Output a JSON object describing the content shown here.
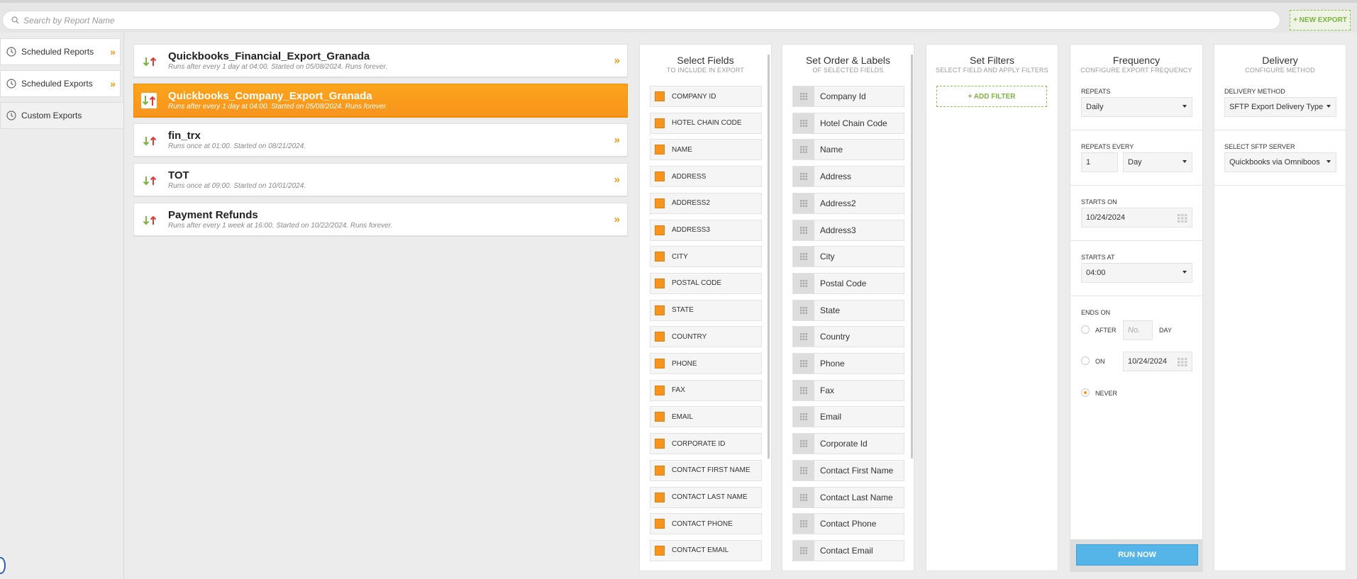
{
  "search": {
    "placeholder": "Search by Report Name"
  },
  "header": {
    "new_export_label": "+ NEW EXPORT"
  },
  "sidebar": {
    "items": [
      {
        "label": "Scheduled Reports",
        "chevron": "»"
      },
      {
        "label": "Scheduled Exports",
        "chevron": "»"
      },
      {
        "label": "Custom Exports"
      }
    ]
  },
  "reports": [
    {
      "title": "Quickbooks_Financial_Export_Granada",
      "subtitle": "Runs after every 1 day at 04:00. Started on 05/08/2024. Runs forever.",
      "chevron": "»"
    },
    {
      "title": "Quickbooks_Company_Export_Granada",
      "subtitle": "Runs after every 1 day at 04:00. Started on 05/08/2024. Runs forever."
    },
    {
      "title": "fin_trx",
      "subtitle": "Runs once at 01:00. Started on 08/21/2024.",
      "chevron": "»"
    },
    {
      "title": "TOT",
      "subtitle": "Runs once at 09:00. Started on 10/01/2024.",
      "chevron": "»"
    },
    {
      "title": "Payment Refunds",
      "subtitle": "Runs after every 1 week at 16:00. Started on 10/22/2024. Runs forever.",
      "chevron": "»"
    }
  ],
  "select_fields": {
    "title": "Select Fields",
    "subtitle": "TO INCLUDE IN EXPORT",
    "items": [
      "COMPANY ID",
      "HOTEL CHAIN CODE",
      "NAME",
      "ADDRESS",
      "ADDRESS2",
      "ADDRESS3",
      "CITY",
      "POSTAL CODE",
      "STATE",
      "COUNTRY",
      "PHONE",
      "FAX",
      "EMAIL",
      "CORPORATE ID",
      "CONTACT FIRST NAME",
      "CONTACT LAST NAME",
      "CONTACT PHONE",
      "CONTACT EMAIL"
    ]
  },
  "order_labels": {
    "title": "Set Order & Labels",
    "subtitle": "OF SELECTED FIELDS",
    "items": [
      "Company Id",
      "Hotel Chain Code",
      "Name",
      "Address",
      "Address2",
      "Address3",
      "City",
      "Postal Code",
      "State",
      "Country",
      "Phone",
      "Fax",
      "Email",
      "Corporate Id",
      "Contact First Name",
      "Contact Last Name",
      "Contact Phone",
      "Contact Email"
    ]
  },
  "filters": {
    "title": "Set Filters",
    "subtitle": "SELECT FIELD AND APPLY FILTERS",
    "add_label": "+ ADD FILTER"
  },
  "frequency": {
    "title": "Frequency",
    "subtitle": "CONFIGURE EXPORT FREQUENCY",
    "repeats_label": "REPEATS",
    "repeats_value": "Daily",
    "repeats_every_label": "REPEATS EVERY",
    "repeats_every_value": "1",
    "repeats_every_unit": "Day",
    "starts_on_label": "STARTS ON",
    "starts_on_value": "10/24/2024",
    "starts_at_label": "STARTS AT",
    "starts_at_value": "04:00",
    "ends_on_label": "ENDS ON",
    "after_label": "AFTER",
    "after_placeholder": "No.",
    "after_unit": "DAY",
    "on_label": "ON",
    "on_value": "10/24/2024",
    "never_label": "NEVER",
    "selected_end": "NEVER",
    "run_now_label": "RUN NOW"
  },
  "delivery": {
    "title": "Delivery",
    "subtitle": "CONFIGURE METHOD",
    "method_label": "DELIVERY METHOD",
    "method_value": "SFTP Export Delivery Type",
    "server_label": "SELECT SFTP SERVER",
    "server_value": "Quickbooks via Omniboos"
  },
  "colors": {
    "accent": "#f7941d",
    "green": "#7cb342",
    "run_button": "#55b5e8"
  }
}
